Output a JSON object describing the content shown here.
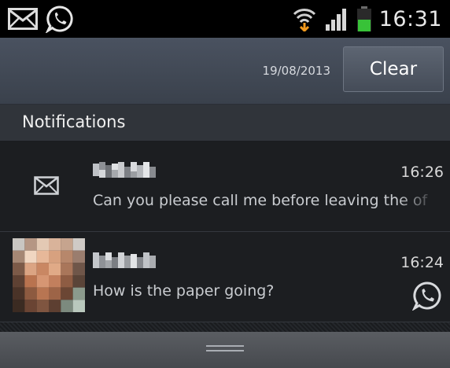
{
  "status_bar": {
    "time": "16:31",
    "left_icons": [
      "envelope-icon",
      "whatsapp-icon"
    ],
    "right_icons": [
      "wifi-icon",
      "signal-icon",
      "battery-icon"
    ]
  },
  "header": {
    "date": "19/08/2013",
    "clear_label": "Clear"
  },
  "section": {
    "title": "Notifications"
  },
  "notifications": [
    {
      "sender": "",
      "time": "16:26",
      "message": "Can you please call me before leaving the of",
      "icon": "envelope-icon"
    },
    {
      "sender": "",
      "time": "16:24",
      "message": "How is the paper going?",
      "icon": "whatsapp-icon"
    }
  ],
  "colors": {
    "status_bg": "#000000",
    "header_bg": "#3f4651",
    "panel_bg": "#1c1e21",
    "battery_green": "#38c238"
  }
}
